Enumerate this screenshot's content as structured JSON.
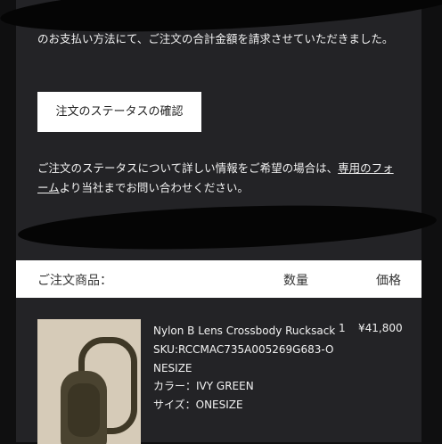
{
  "message": {
    "paragraph1": "のお支払い方法にて、ご注文の合計金額を請求させていただきました。",
    "paragraph2_before": "ご注文のステータスについて詳しい情報をご希望の場合は、",
    "paragraph2_link": "専用のフォーム",
    "paragraph2_after": "より当社までお問い合わせください。"
  },
  "status_button": {
    "label": "注文のステータスの確認"
  },
  "items_header": {
    "title": "ご注文商品：",
    "qty_label": "数量",
    "price_label": "価格"
  },
  "item": {
    "name": "Nylon B Lens Crossbody Rucksack",
    "sku": "SKU:RCCMAC735A005269G683-ONESIZE",
    "color": "カラー：IVY GREEN",
    "size": "サイズ：ONESIZE",
    "quantity": "1",
    "price": "¥41,800"
  }
}
